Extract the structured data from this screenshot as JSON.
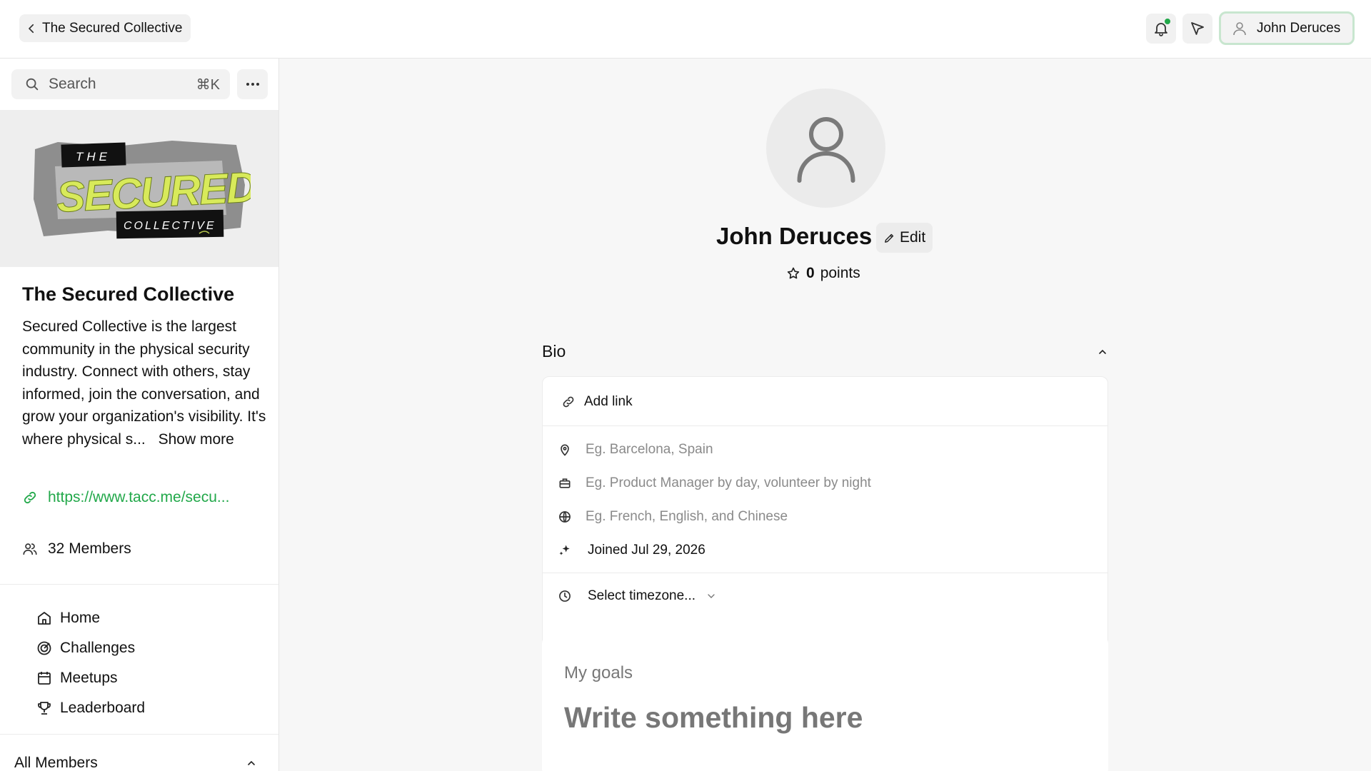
{
  "topbar": {
    "back_label": "The Secured Collective",
    "user_name": "John Deruces",
    "colors": {
      "notification_dot": "#22a84a",
      "user_button_border": "#c8e6cf"
    }
  },
  "sidebar": {
    "search": {
      "placeholder": "Search",
      "shortcut": "⌘K"
    },
    "banner": {
      "line1": "THE",
      "line2": "SECURED",
      "line3": "COLLECTIVE"
    },
    "community": {
      "title": "The Secured Collective",
      "description": "Secured Collective is the largest community in the physical security industry. Connect with others, stay informed, join the conversation, and grow your organization's visibility. It's where physical s...",
      "show_more": "Show more",
      "link": "https://www.tacc.me/secu...",
      "members": "32 Members"
    },
    "nav": [
      {
        "label": "Home",
        "icon": "home-icon"
      },
      {
        "label": "Challenges",
        "icon": "target-icon"
      },
      {
        "label": "Meetups",
        "icon": "calendar-icon"
      },
      {
        "label": "Leaderboard",
        "icon": "trophy-icon"
      }
    ],
    "all_members_label": "All Members"
  },
  "profile": {
    "name": "John Deruces",
    "edit_label": "Edit",
    "points_value": "0",
    "points_label": "points",
    "bio": {
      "heading": "Bio",
      "add_link": "Add link",
      "location_placeholder": "Eg. Barcelona, Spain",
      "occupation_placeholder": "Eg. Product Manager by day, volunteer by night",
      "languages_placeholder": "Eg. French, English, and Chinese",
      "joined": "Joined Jul 29, 2026",
      "timezone_select": "Select timezone..."
    },
    "goals": {
      "label": "My goals",
      "placeholder": "Write something here"
    }
  }
}
